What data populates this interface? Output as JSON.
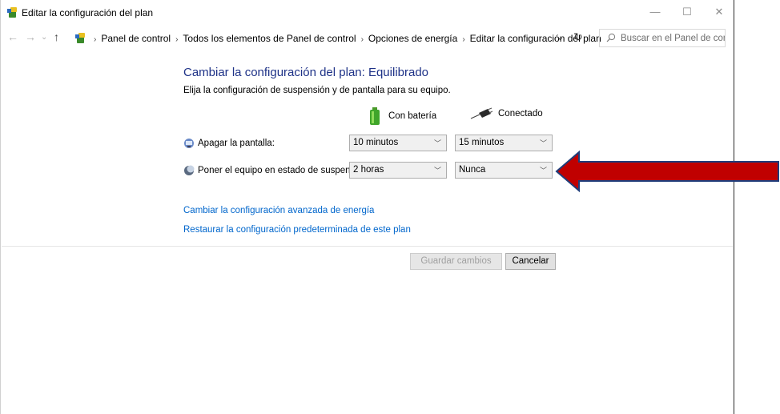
{
  "window": {
    "title": "Editar la configuración del plan",
    "minimize": "—",
    "maximize": "☐",
    "close": "✕"
  },
  "nav": {
    "back": "←",
    "forward": "→",
    "recent": "⌄",
    "up": "↑",
    "breadcrumbs": [
      "Panel de control",
      "Todos los elementos de Panel de control",
      "Opciones de energía",
      "Editar la configuración del plan"
    ],
    "separator": "›",
    "dropdown": "⌄",
    "refresh": "↻"
  },
  "search": {
    "placeholder": "Buscar en el Panel de control"
  },
  "page": {
    "title": "Cambiar la configuración del plan: Equilibrado",
    "subtitle": "Elija la configuración de suspensión y de pantalla para su equipo."
  },
  "columns": {
    "battery": "Con batería",
    "plugged": "Conectado"
  },
  "rows": [
    {
      "label": "Apagar la pantalla:",
      "battery_value": "10 minutos",
      "plugged_value": "15 minutos",
      "icon": "display-icon"
    },
    {
      "label": "Poner el equipo en estado de suspensión:",
      "battery_value": "2 horas",
      "plugged_value": "Nunca",
      "icon": "moon-icon"
    }
  ],
  "links": {
    "advanced": "Cambiar la configuración avanzada de energía",
    "restore": "Restaurar la configuración predeterminada de este plan"
  },
  "buttons": {
    "save": "Guardar cambios",
    "cancel": "Cancelar"
  },
  "annotation": {
    "arrow_color": "#c00000",
    "arrow_outline": "#1f3d7a"
  },
  "colors": {
    "title": "#1e3287",
    "link": "#0066cc"
  }
}
